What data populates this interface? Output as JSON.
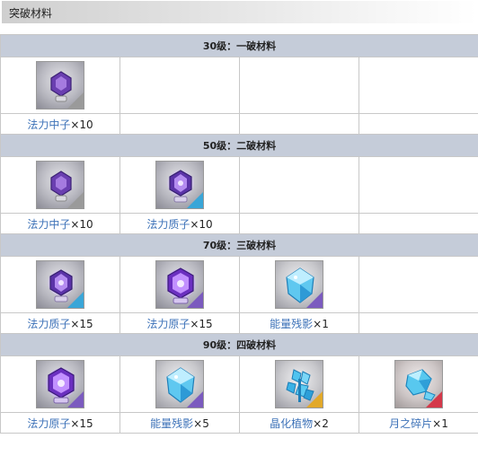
{
  "title": "突破材料",
  "rarity_colors": {
    "grey": "#9a9a9a",
    "blue": "#3aa6d8",
    "purple": "#7b5bbf",
    "gold": "#e2a92a",
    "red": "#d4394a"
  },
  "sections": [
    {
      "header": "30级：一破材料",
      "items": [
        {
          "name": "法力中子",
          "qty": "×10",
          "icon": "mana-neutron-icon"
        }
      ]
    },
    {
      "header": "50级：二破材料",
      "items": [
        {
          "name": "法力中子",
          "qty": "×10",
          "icon": "mana-neutron-icon"
        },
        {
          "name": "法力质子",
          "qty": "×10",
          "icon": "mana-proton-icon"
        }
      ]
    },
    {
      "header": "70级：三破材料",
      "items": [
        {
          "name": "法力质子",
          "qty": "×15",
          "icon": "mana-proton-icon"
        },
        {
          "name": "法力原子",
          "qty": "×15",
          "icon": "mana-atom-icon"
        },
        {
          "name": "能量残影",
          "qty": "×1",
          "icon": "energy-afterimage-icon"
        }
      ]
    },
    {
      "header": "90级：四破材料",
      "items": [
        {
          "name": "法力原子",
          "qty": "×15",
          "icon": "mana-atom-icon"
        },
        {
          "name": "能量残影",
          "qty": "×5",
          "icon": "energy-afterimage-icon"
        },
        {
          "name": "晶化植物",
          "qty": "×2",
          "icon": "crystallized-plant-icon"
        },
        {
          "name": "月之碎片",
          "qty": "×1",
          "icon": "moon-fragment-icon"
        }
      ]
    }
  ]
}
